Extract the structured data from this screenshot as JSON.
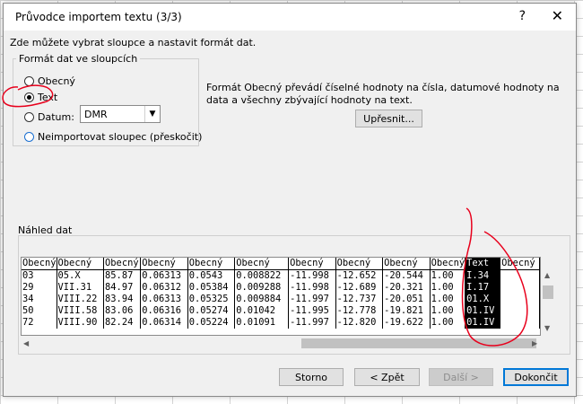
{
  "dialog": {
    "title": "Průvodce importem textu (3/3)",
    "help_glyph": "?",
    "close_glyph": "✕",
    "intro": "Zde můžete vybrat sloupce a nastavit formát dat."
  },
  "format_group": {
    "legend": "Formát dat ve sloupcích",
    "options": {
      "general": "Obecný",
      "text": "Text",
      "date": "Datum:",
      "skip": "Neimportovat sloupec (přeskočit)"
    },
    "selected": "text",
    "date_format": "DMR"
  },
  "description": "Formát Obecný převádí číselné hodnoty na čísla, datumové hodnoty na data a všechny zbývající hodnoty na text.",
  "advanced_button": "Upřesnit...",
  "preview": {
    "label": "Náhled dat",
    "headers": [
      "Obecný",
      "Obecný",
      "Obecný",
      "Obecný",
      "Obecný",
      "Obecný",
      "Obecný",
      "Obecný",
      "Obecný",
      "Obecný",
      "Text",
      "Obecný"
    ],
    "rows": [
      [
        "03",
        "05.X",
        "85.87",
        "0.06313",
        "0.0543",
        "0.008822",
        "-11.998",
        "-12.652",
        "-20.544",
        "1.00",
        "I.34",
        ""
      ],
      [
        "29",
        "VII.31",
        "84.97",
        "0.06312",
        "0.05384",
        "0.009288",
        "-11.998",
        "-12.689",
        "-20.321",
        "1.00",
        "I.17",
        ""
      ],
      [
        "34",
        "VIII.22",
        "83.94",
        "0.06313",
        "0.05325",
        "0.009884",
        "-11.997",
        "-12.737",
        "-20.051",
        "1.00",
        "01.X",
        ""
      ],
      [
        "50",
        "VIII.58",
        "83.06",
        "0.06316",
        "0.05274",
        "0.01042",
        "-11.995",
        "-12.778",
        "-19.821",
        "1.00",
        "01.IV",
        ""
      ],
      [
        "72",
        "VIII.90",
        "82.24",
        "0.06314",
        "0.05224",
        "0.01091",
        "-11.997",
        "-12.820",
        "-19.622",
        "1.00",
        "01.IV",
        ""
      ]
    ]
  },
  "buttons": {
    "cancel": "Storno",
    "back": "< Zpět",
    "next": "Další >",
    "finish": "Dokončit"
  },
  "colors": {
    "annotation": "#e8001c",
    "accent": "#0078d7"
  }
}
